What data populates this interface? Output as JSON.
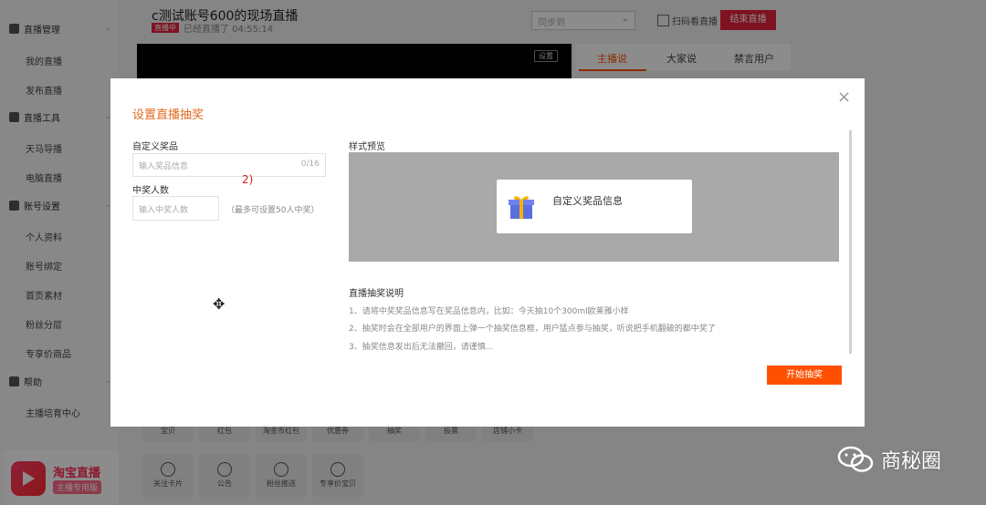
{
  "sidebar": {
    "groups": [
      {
        "label": "直播管理",
        "items": [
          "我的直播",
          "发布直播"
        ]
      },
      {
        "label": "直播工具",
        "items": [
          "天马导播",
          "电脑直播"
        ]
      },
      {
        "label": "账号设置",
        "items": [
          "个人资料",
          "账号绑定",
          "首页素材",
          "粉丝分层",
          "专享价商品"
        ]
      },
      {
        "label": "帮助",
        "items": [
          "主播培育中心"
        ]
      }
    ],
    "brand": {
      "name": "淘宝直播",
      "subtitle": "主播专用版"
    }
  },
  "header": {
    "title": "c测试账号600的现场直播",
    "live_badge": "直播中",
    "live_time": "已经直播了 04:55:14",
    "sync_select": "同步到",
    "qr_label": "扫码看直播",
    "end_label": "结束直播",
    "video_setting": "设置"
  },
  "right_tabs": [
    "主播说",
    "大家说",
    "禁言用户"
  ],
  "tools": {
    "row1": [
      "宝贝",
      "红包",
      "淘金币红包",
      "优惠券",
      "抽奖",
      "投票",
      "店铺小卡"
    ],
    "row2": [
      "关注卡片",
      "公告",
      "粉丝推送",
      "专享价宝贝"
    ]
  },
  "modal": {
    "title": "设置直播抽奖",
    "prize_label": "自定义奖品",
    "prize_placeholder": "输入奖品信息",
    "prize_counter": "0/16",
    "winners_label": "中奖人数",
    "winners_placeholder": "输入中奖人数",
    "winners_hint": "（最多可设置50人中奖）",
    "annotation": "2)",
    "preview_label": "样式预览",
    "preview_card_text": "自定义奖品信息",
    "rules_title": "直播抽奖说明",
    "rules": [
      "1、请将中奖奖品信息写在奖品信息内，比如：今天抽10个300ml欧莱雅小样",
      "2、抽奖时会在全部用户的界面上弹一个抽奖信息框，用户猛点参与抽奖，听说把手机翻破的都中奖了",
      "3、抽奖信息发出后无法撤回，请谨慎..."
    ],
    "start_label": "开始抽奖",
    "close_glyph": "×"
  },
  "watermark": {
    "text": "商秘圈"
  },
  "colors": {
    "accent": "#ff5000",
    "live_red": "#e8213d",
    "title_orange": "#e26a1f"
  }
}
